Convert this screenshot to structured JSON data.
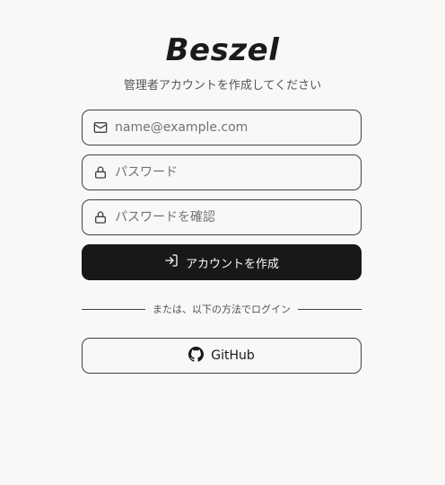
{
  "brand": {
    "logo_text": "Beszel"
  },
  "form": {
    "subtitle": "管理者アカウントを作成してください",
    "email": {
      "placeholder": "name@example.com",
      "icon": "mail-icon"
    },
    "password": {
      "placeholder": "パスワード",
      "icon": "lock-icon"
    },
    "confirm_password": {
      "placeholder": "パスワードを確認",
      "icon": "lock-icon"
    },
    "submit_label": "アカウントを作成",
    "divider_text": "または、以下の方法でログイン",
    "github_label": "GitHub"
  },
  "colors": {
    "background": "#f9f8f7",
    "primary_button": "#18181b",
    "border": "#3f3f46"
  }
}
